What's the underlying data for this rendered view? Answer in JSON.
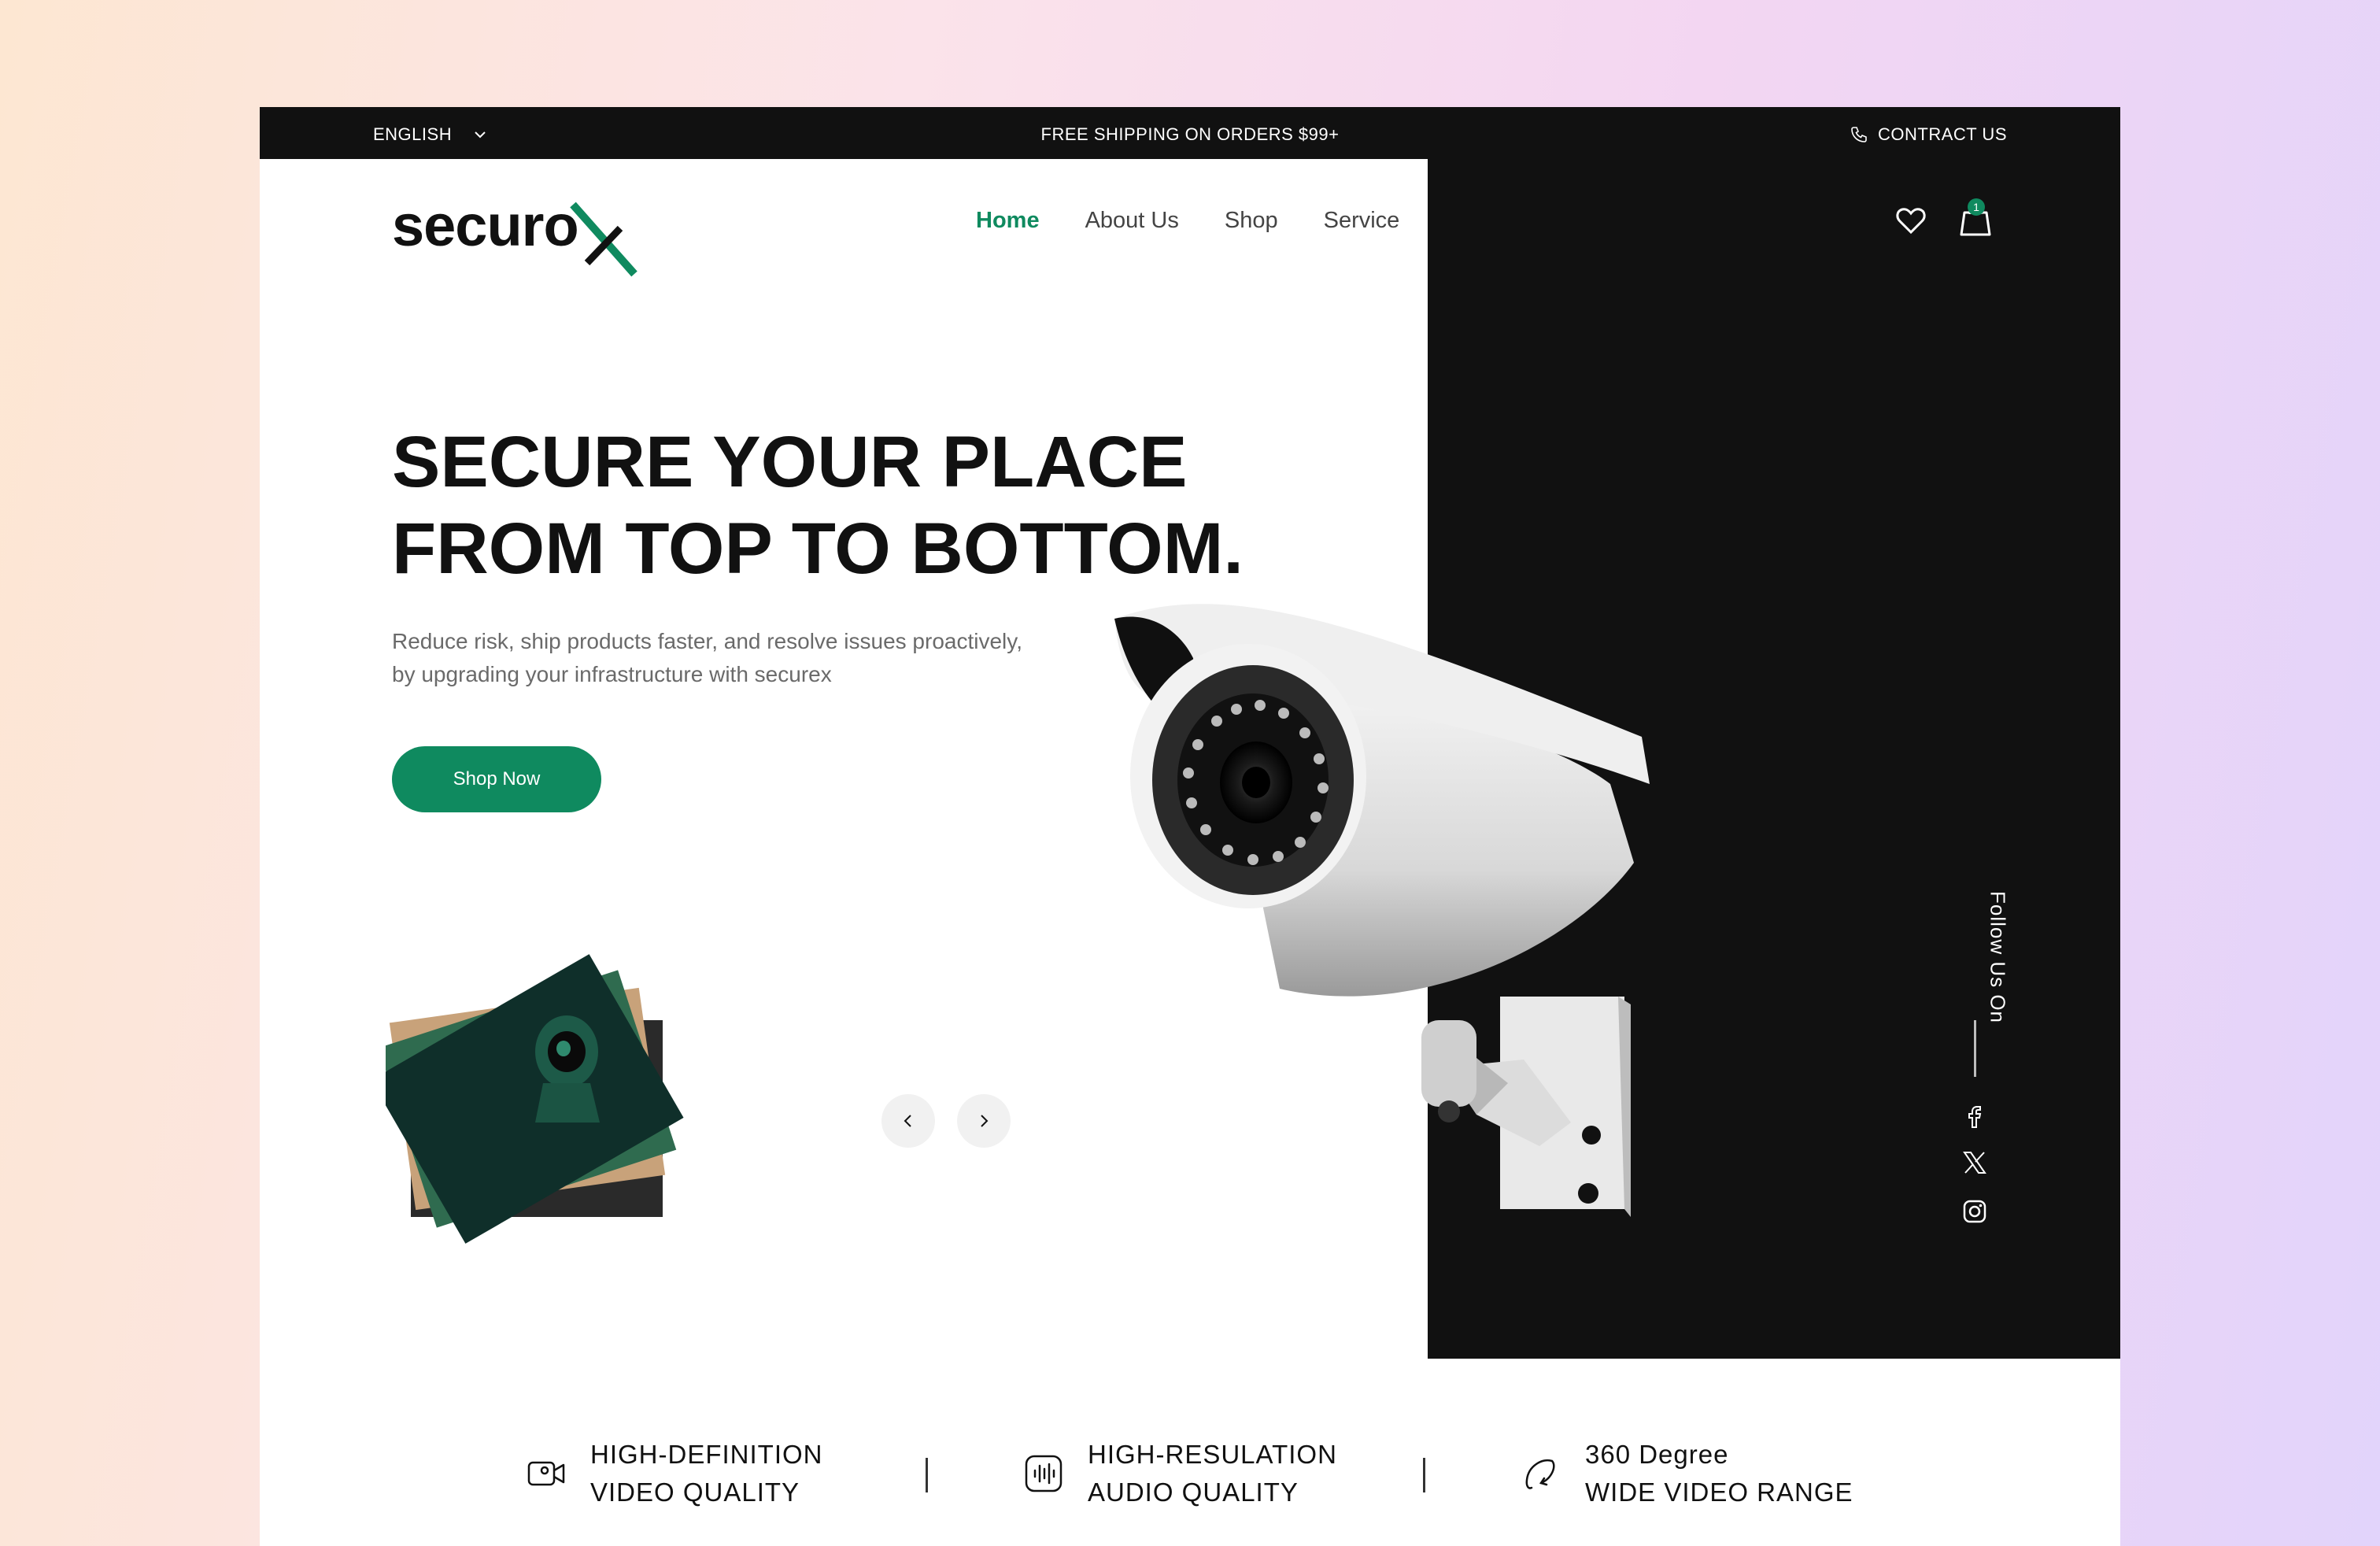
{
  "topbar": {
    "language": "ENGLISH",
    "shipping": "FREE SHIPPING ON ORDERS $99+",
    "contact": "CONTRACT US"
  },
  "brand": {
    "logo_text": "securo",
    "logo_accent_letter": "x",
    "accent_color": "#0f8a5f"
  },
  "nav": {
    "items": [
      "Home",
      "About Us",
      "Shop",
      "Service"
    ],
    "active": "Home"
  },
  "header": {
    "cart_count": "1"
  },
  "hero": {
    "title_line1": "SECURE YOUR PLACE",
    "title_line2": "FROM TOP TO BOTTOM.",
    "description": "Reduce risk, ship products faster, and resolve issues proactively, by upgrading your infrastructure with securex",
    "cta": "Shop Now"
  },
  "social": {
    "label": "Follow Us On",
    "icons": [
      "facebook-icon",
      "x-twitter-icon",
      "instagram-icon"
    ]
  },
  "features": [
    {
      "icon": "video-camera-icon",
      "line1": "HIGH-DEFINITION",
      "line2": "VIDEO QUALITY"
    },
    {
      "icon": "audio-wave-icon",
      "line1": "HIGH-RESULATION",
      "line2": "AUDIO QUALITY"
    },
    {
      "icon": "rotate-360-icon",
      "line1": "360 Degree",
      "line2": "WIDE VIDEO RANGE"
    }
  ],
  "colors": {
    "dark": "#111111",
    "green": "#0f8a5f",
    "white": "#ffffff"
  }
}
